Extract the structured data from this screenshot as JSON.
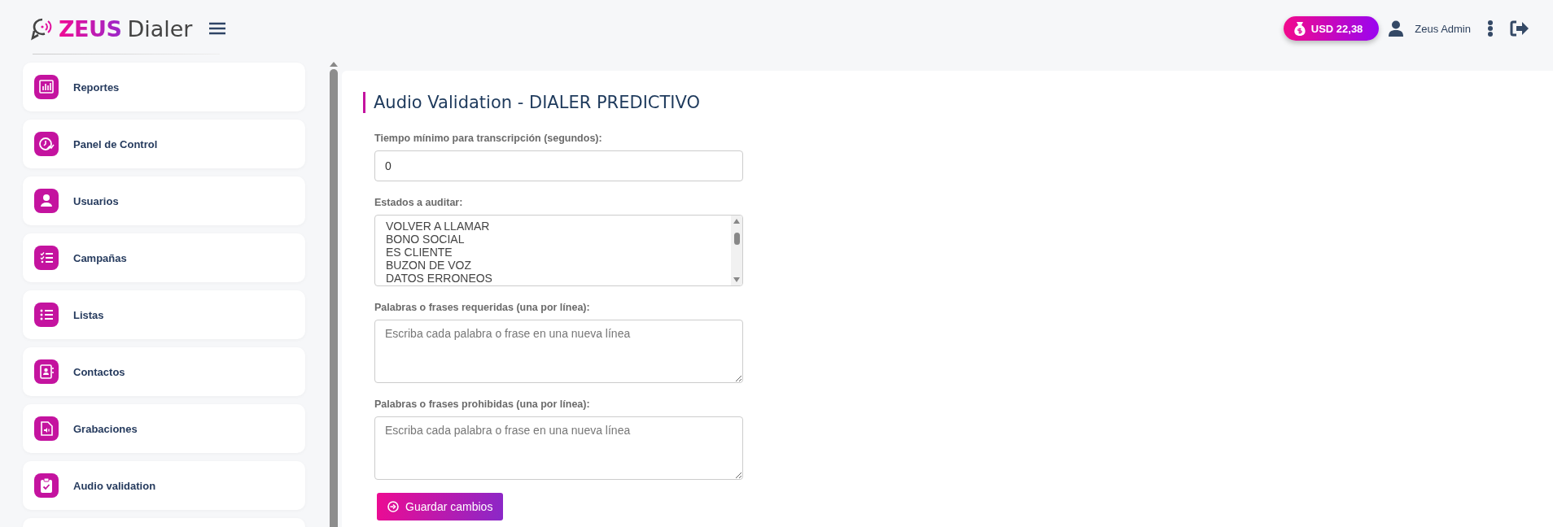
{
  "header": {
    "logo": {
      "brand": "ZEUS",
      "product": "Dialer"
    },
    "balance": "USD 22,38",
    "user": "Zeus Admin"
  },
  "sidebar": {
    "items": [
      {
        "label": "Reportes",
        "kind": "chart"
      },
      {
        "label": "Panel de Control",
        "kind": "dashboard"
      },
      {
        "label": "Usuarios",
        "kind": "user"
      },
      {
        "label": "Campañas",
        "kind": "checklist"
      },
      {
        "label": "Listas",
        "kind": "list"
      },
      {
        "label": "Contactos",
        "kind": "contacts"
      },
      {
        "label": "Grabaciones",
        "kind": "audio"
      },
      {
        "label": "Audio validation",
        "kind": "clipboard"
      }
    ]
  },
  "page": {
    "title": "Audio Validation - DIALER PREDICTIVO",
    "fields": [
      {
        "kind": "text",
        "label": "Tiempo mínimo para transcripción (segundos):",
        "value": "0"
      },
      {
        "kind": "listbox",
        "label": "Estados a auditar:",
        "options": [
          "VOLVER A LLAMAR",
          "BONO SOCIAL",
          "ES CLIENTE",
          "BUZON DE VOZ",
          "DATOS ERRONEOS"
        ]
      },
      {
        "kind": "textarea",
        "label": "Palabras o frases requeridas (una por línea):",
        "placeholder": "Escriba cada palabra o frase en una nueva línea"
      },
      {
        "kind": "textarea",
        "label": "Palabras o frases prohibidas (una por línea):",
        "placeholder": "Escriba cada palabra o frase en una nueva línea"
      }
    ],
    "save_button": "Guardar cambios"
  }
}
